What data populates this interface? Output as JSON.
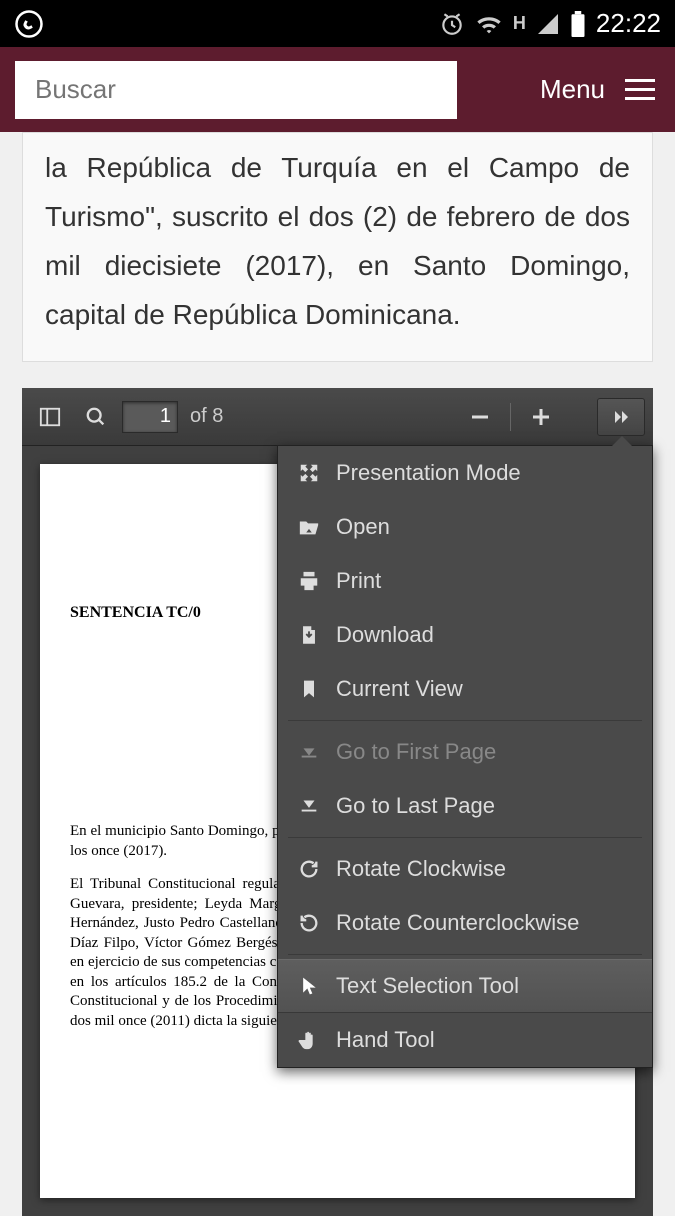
{
  "status": {
    "time": "22:22",
    "network_label": "H"
  },
  "header": {
    "search_placeholder": "Buscar",
    "menu_label": "Menu"
  },
  "description_text": "la República de Turquía en el Campo de Turismo\", suscrito el dos (2) de febrero de dos mil diecisiete (2017), en Santo Domingo, capital de República Dominicana.",
  "pdf": {
    "toolbar": {
      "current_page": "1",
      "page_total_prefix": "of",
      "page_total": "8"
    },
    "page": {
      "heading": "SENTENCIA TC/0",
      "para1": "En el municipio Santo Domingo, provincia de Santo Domingo, República Dominicana, a los once (2017).",
      "para2": "El Tribunal Constitucional regularmente constituido por los magistrados Milton Ray Guevara, presidente; Leyda Margarita Piña Medrano, primera sustituta; Hermógenes Hernández, Justo Pedro Castellanos Khoury, Víctor Joaquín Castellanos Pizano, Rafael Díaz Filpo, Víctor Gómez Bergés, Wilson S. Gómez Ramírez, Katia Miguelina Reyes, en ejercicio de sus competencias constitucionales y legales, específicamente las previstas en los artículos 185.2 de la Constitución y 9 y 36 de la Ley Orgánica del Tribunal Constitucional y de los Procedimientos Constitucionales del trece (13) de junio del año dos mil once (2011) dicta la siguiente sentencia:"
    },
    "menu": {
      "presentation": "Presentation Mode",
      "open": "Open",
      "print": "Print",
      "download": "Download",
      "current_view": "Current View",
      "first_page": "Go to First Page",
      "last_page": "Go to Last Page",
      "rotate_cw": "Rotate Clockwise",
      "rotate_ccw": "Rotate Counterclockwise",
      "text_select": "Text Selection Tool",
      "hand_tool": "Hand Tool"
    }
  }
}
